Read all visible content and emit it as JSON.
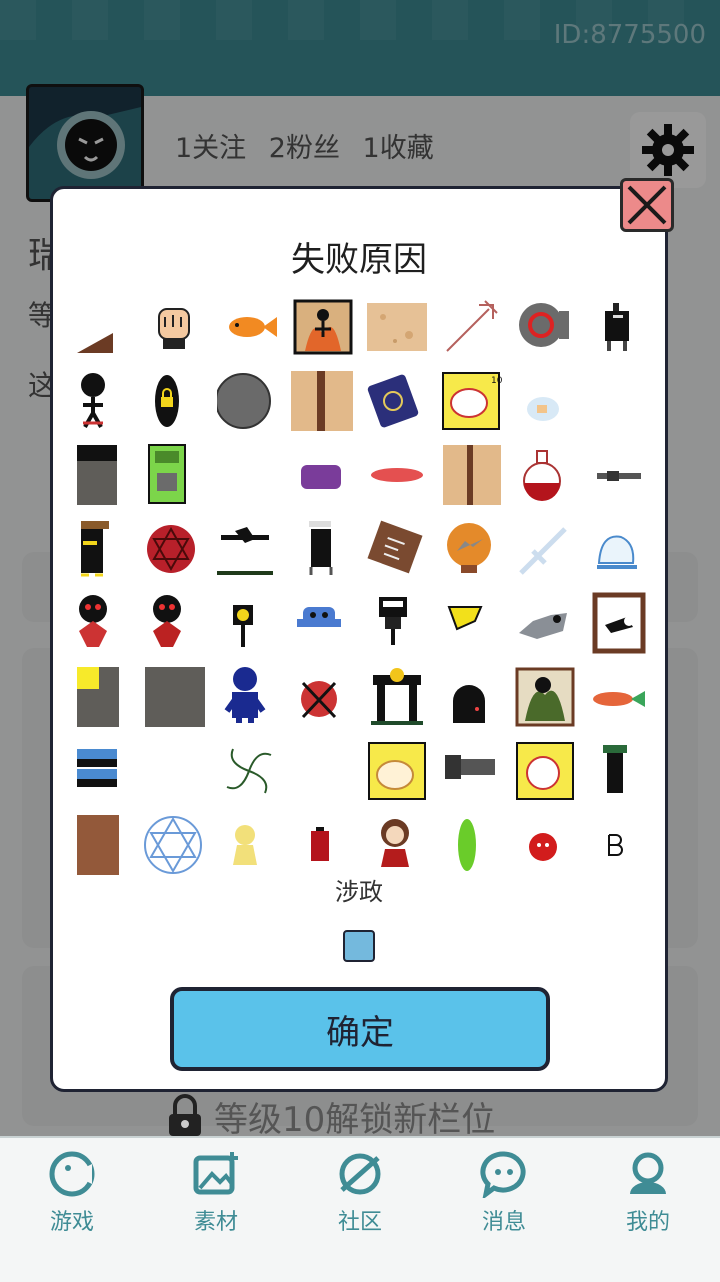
{
  "header": {
    "user_id": "ID:8775500"
  },
  "profile": {
    "stats": "1关注 2粉丝 1收藏"
  },
  "background_texts": {
    "name_initial": "瑞",
    "line2": "等",
    "line3": "这"
  },
  "dialog": {
    "title": "失败原因",
    "selected_label": "涉政",
    "confirm_label": "确定"
  },
  "unlock_text": "等级10解锁新栏位",
  "tabs": [
    {
      "label": "游戏",
      "icon": "game-icon"
    },
    {
      "label": "素材",
      "icon": "image-add-icon"
    },
    {
      "label": "社区",
      "icon": "planet-icon"
    },
    {
      "label": "消息",
      "icon": "chat-icon"
    },
    {
      "label": "我的",
      "icon": "user-icon"
    }
  ],
  "colors": {
    "header": "#3f8c95",
    "accent": "#5ac2ea",
    "close": "#ec8a8a",
    "checkbox": "#74b9dd"
  },
  "badges": {
    "level": "10"
  },
  "grid_items": [
    "ramp-icon",
    "fist-icon",
    "fish-icon",
    "fire-stickman-icon",
    "sand-tile-icon",
    "trident-icon",
    "camera-icon",
    "black-robot-icon",
    "stickman-icon",
    "lock-egg-icon",
    "gray-circle-icon",
    "wood-door-icon",
    "spell-book-icon",
    "pig-card-icon",
    "none",
    "small-pot-icon",
    "dark-block-icon",
    "green-machine-icon",
    "none",
    "purple-jar-icon",
    "red-disc-icon",
    "wood-panel-icon",
    "potion-icon",
    "gun-icon",
    "hat-stickman-icon",
    "hexagram-icon",
    "cat-platform-icon",
    "white-hat-figure-icon",
    "sign-board-icon",
    "crystal-ball-icon",
    "sword-icon",
    "skate-ghost-icon",
    "red-eye-doll-icon",
    "red-eye-doll-2-icon",
    "lamp-post-icon",
    "blue-robot-icon",
    "hanger-icon",
    "yellow-flag-icon",
    "gray-cat-icon",
    "eye-frame-icon",
    "gray-block-yellow-icon",
    "gray-square-icon",
    "blue-person-icon",
    "red-x-ball-icon",
    "dollar-gate-icon",
    "black-ghost-icon",
    "green-card-icon",
    "red-fish-icon",
    "blue-stripes-icon",
    "none",
    "vortex-icon",
    "none",
    "cat-card-icon",
    "cannon-icon",
    "ghost-card-icon",
    "green-robot-icon",
    "brown-block-icon",
    "magic-circle-icon",
    "fairy-icon",
    "battery-icon",
    "girl-icon",
    "green-leaf-icon",
    "red-ghost-icon",
    "letter-b-icon"
  ]
}
